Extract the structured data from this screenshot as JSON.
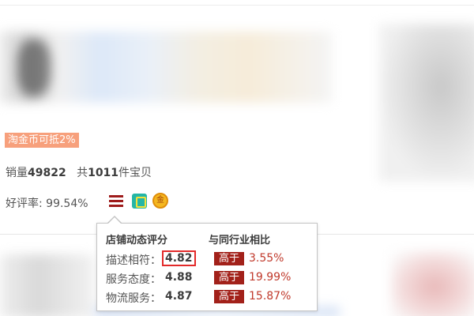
{
  "promo": {
    "text": "淘金币可抵2%"
  },
  "stats": {
    "sales_label": "销量",
    "sales_value": "49822",
    "total_prefix": "共",
    "total_value": "1011",
    "total_suffix": "件宝贝"
  },
  "rating": {
    "text": "好评率: 99.54%"
  },
  "icons": {
    "menu": "menu-icon",
    "shop": "shop-badge-icon",
    "gold": "gold-medal-icon",
    "gold_char": "金"
  },
  "tooltip": {
    "header_left": "店铺动态评分",
    "header_right": "与同行业相比",
    "rows": [
      {
        "label": "描述相符：",
        "score": "4.82",
        "badge": "高于",
        "pct": "3.55%"
      },
      {
        "label": "服务态度：",
        "score": "4.88",
        "badge": "高于",
        "pct": "19.99%"
      },
      {
        "label": "物流服务：",
        "score": "4.87",
        "badge": "高于",
        "pct": "15.87%"
      }
    ]
  },
  "colors": {
    "promo_bg": "#f7a07c",
    "badge_bg": "#a2211a",
    "pct_text": "#c0392b",
    "highlight_border": "#e32a2a"
  }
}
